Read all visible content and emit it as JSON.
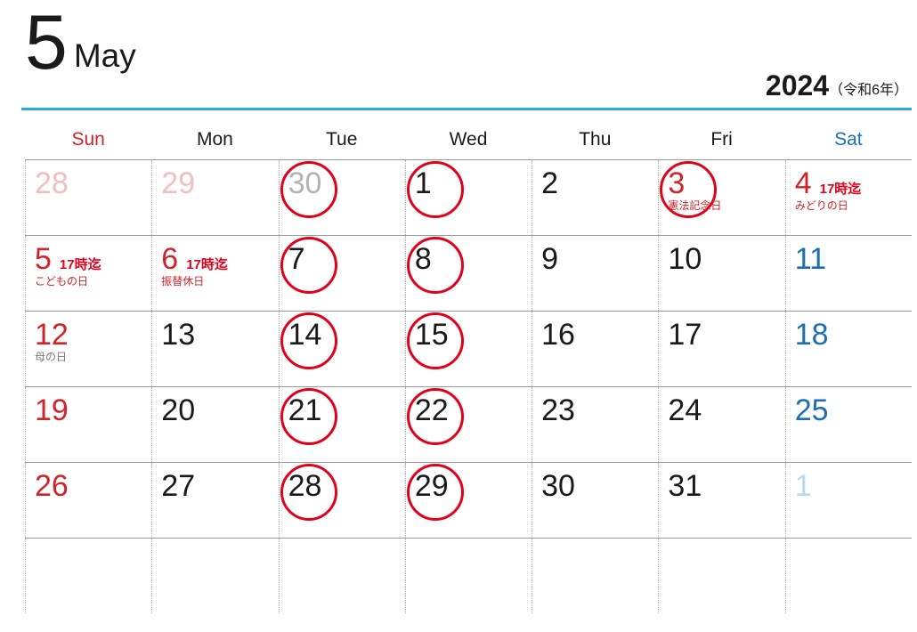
{
  "header": {
    "month_number": "5",
    "month_name": "May",
    "year": "2024",
    "era": "（令和6年）",
    "rule_color": "#29abe2"
  },
  "weekdays": [
    {
      "label": "Sun",
      "color": "#d1232a"
    },
    {
      "label": "Mon",
      "color": "#1a1a1a"
    },
    {
      "label": "Tue",
      "color": "#1a1a1a"
    },
    {
      "label": "Wed",
      "color": "#1a1a1a"
    },
    {
      "label": "Thu",
      "color": "#1a1a1a"
    },
    {
      "label": "Fri",
      "color": "#1a1a1a"
    },
    {
      "label": "Sat",
      "color": "#1c6fb0"
    }
  ],
  "colors": {
    "sunday": "#d1232a",
    "saturday": "#1c6fb0",
    "weekday": "#1a1a1a",
    "holiday": "#d1232a",
    "circle": "#e2001a",
    "note": "#e2001a",
    "label_gray": "#7a7a7a",
    "other_month_sun": "#f2bfc0",
    "other_month_gray": "#b3b3b3",
    "other_month_sat": "#b9d9ee"
  },
  "weeks": [
    [
      {
        "num": "28",
        "style": "other-sun",
        "circled": false,
        "note": "",
        "label": ""
      },
      {
        "num": "29",
        "style": "other-sun",
        "circled": false,
        "note": "",
        "label": ""
      },
      {
        "num": "30",
        "style": "other-gray",
        "circled": true,
        "note": "",
        "label": ""
      },
      {
        "num": "1",
        "style": "weekday",
        "circled": true,
        "note": "",
        "label": ""
      },
      {
        "num": "2",
        "style": "weekday",
        "circled": false,
        "note": "",
        "label": ""
      },
      {
        "num": "3",
        "style": "holiday",
        "circled": true,
        "note": "",
        "label": "憲法記念日"
      },
      {
        "num": "4",
        "style": "holiday",
        "circled": false,
        "note": "17時迄",
        "label": "みどりの日"
      }
    ],
    [
      {
        "num": "5",
        "style": "holiday",
        "circled": false,
        "note": "17時迄",
        "label": "こどもの日"
      },
      {
        "num": "6",
        "style": "holiday",
        "circled": false,
        "note": "17時迄",
        "label": "振替休日"
      },
      {
        "num": "7",
        "style": "weekday",
        "circled": true,
        "note": "",
        "label": ""
      },
      {
        "num": "8",
        "style": "weekday",
        "circled": true,
        "note": "",
        "label": ""
      },
      {
        "num": "9",
        "style": "weekday",
        "circled": false,
        "note": "",
        "label": ""
      },
      {
        "num": "10",
        "style": "weekday",
        "circled": false,
        "note": "",
        "label": ""
      },
      {
        "num": "11",
        "style": "sat",
        "circled": false,
        "note": "",
        "label": ""
      }
    ],
    [
      {
        "num": "12",
        "style": "sun",
        "circled": false,
        "note": "",
        "label": "母の日",
        "label_gray": true
      },
      {
        "num": "13",
        "style": "weekday",
        "circled": false,
        "note": "",
        "label": ""
      },
      {
        "num": "14",
        "style": "weekday",
        "circled": true,
        "note": "",
        "label": ""
      },
      {
        "num": "15",
        "style": "weekday",
        "circled": true,
        "note": "",
        "label": ""
      },
      {
        "num": "16",
        "style": "weekday",
        "circled": false,
        "note": "",
        "label": ""
      },
      {
        "num": "17",
        "style": "weekday",
        "circled": false,
        "note": "",
        "label": ""
      },
      {
        "num": "18",
        "style": "sat",
        "circled": false,
        "note": "",
        "label": ""
      }
    ],
    [
      {
        "num": "19",
        "style": "sun",
        "circled": false,
        "note": "",
        "label": ""
      },
      {
        "num": "20",
        "style": "weekday",
        "circled": false,
        "note": "",
        "label": ""
      },
      {
        "num": "21",
        "style": "weekday",
        "circled": true,
        "note": "",
        "label": ""
      },
      {
        "num": "22",
        "style": "weekday",
        "circled": true,
        "note": "",
        "label": ""
      },
      {
        "num": "23",
        "style": "weekday",
        "circled": false,
        "note": "",
        "label": ""
      },
      {
        "num": "24",
        "style": "weekday",
        "circled": false,
        "note": "",
        "label": ""
      },
      {
        "num": "25",
        "style": "sat",
        "circled": false,
        "note": "",
        "label": ""
      }
    ],
    [
      {
        "num": "26",
        "style": "sun",
        "circled": false,
        "note": "",
        "label": ""
      },
      {
        "num": "27",
        "style": "weekday",
        "circled": false,
        "note": "",
        "label": ""
      },
      {
        "num": "28",
        "style": "weekday",
        "circled": true,
        "note": "",
        "label": ""
      },
      {
        "num": "29",
        "style": "weekday",
        "circled": true,
        "note": "",
        "label": ""
      },
      {
        "num": "30",
        "style": "weekday",
        "circled": false,
        "note": "",
        "label": ""
      },
      {
        "num": "31",
        "style": "weekday",
        "circled": false,
        "note": "",
        "label": ""
      },
      {
        "num": "1",
        "style": "other-sat",
        "circled": false,
        "note": "",
        "label": ""
      }
    ],
    [
      {
        "num": "",
        "style": "weekday",
        "circled": false,
        "note": "",
        "label": ""
      },
      {
        "num": "",
        "style": "weekday",
        "circled": false,
        "note": "",
        "label": ""
      },
      {
        "num": "",
        "style": "weekday",
        "circled": false,
        "note": "",
        "label": ""
      },
      {
        "num": "",
        "style": "weekday",
        "circled": false,
        "note": "",
        "label": ""
      },
      {
        "num": "",
        "style": "weekday",
        "circled": false,
        "note": "",
        "label": ""
      },
      {
        "num": "",
        "style": "weekday",
        "circled": false,
        "note": "",
        "label": ""
      },
      {
        "num": "",
        "style": "weekday",
        "circled": false,
        "note": "",
        "label": ""
      }
    ]
  ]
}
